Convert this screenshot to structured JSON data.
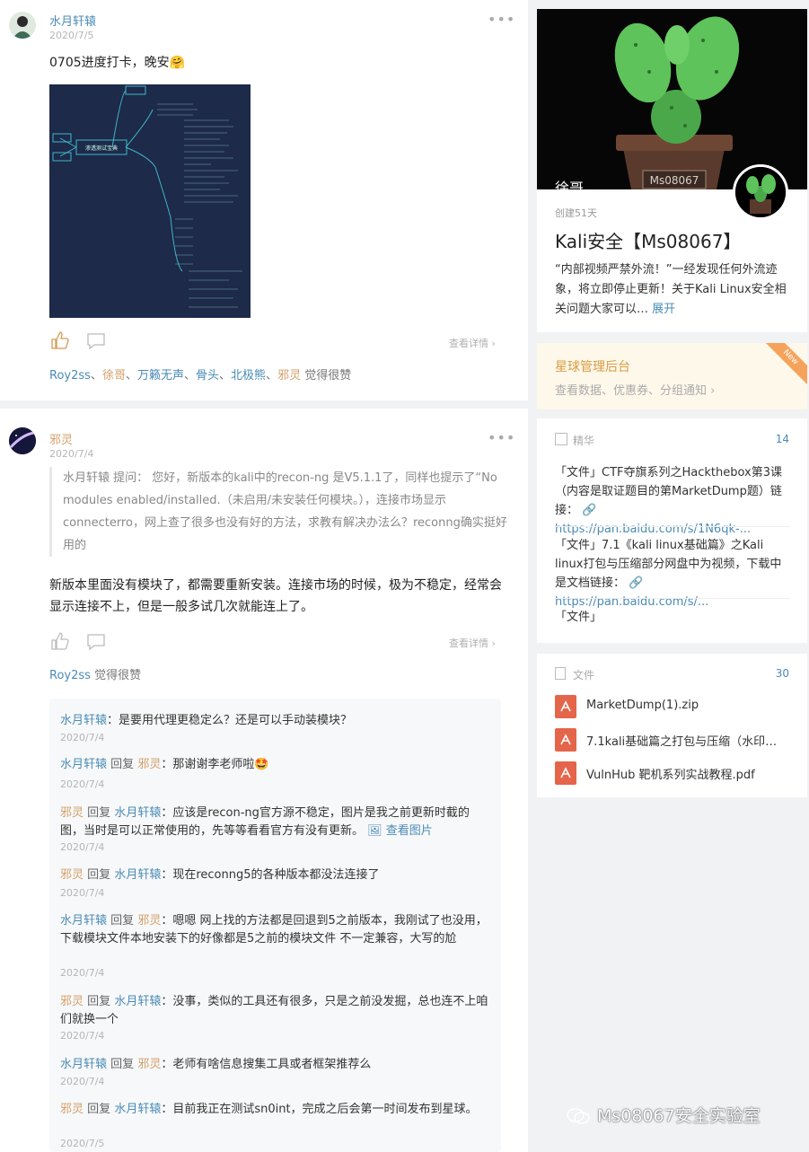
{
  "post1": {
    "author": "水月轩辕",
    "date": "2020/7/5",
    "more": "•••",
    "text": "0705进度打卡，晚安🤗",
    "mindmap_center": "渗透测试宝典",
    "detail_link": "查看详情 ›",
    "likes": {
      "names": [
        "Roy2ss",
        "徐哥",
        "万籁无声",
        "骨头",
        "北极熊",
        "邪灵"
      ],
      "suffix": "觉得很赞"
    }
  },
  "post2": {
    "author": "邪灵",
    "date": "2020/7/4",
    "more": "•••",
    "quote": "水月轩辕  提问：  您好，新版本的kali中的recon-ng 是V5.1.1了，同样也提示了“No modules enabled/installed.（未启用/未安装任何模块。），连接市场显示connecterro，网上查了很多也没有好的方法，求教有解决办法么？reconng确实挺好用的",
    "text": "新版本里面没有模块了，都需要重新安装。连接市场的时候，极为不稳定，经常会显示连接不上，但是一般多试几次就能连上了。",
    "detail_link": "查看详情 ›",
    "likes": {
      "names": [
        "Roy2ss"
      ],
      "suffix": "觉得很赞"
    },
    "comments": [
      {
        "from": "水月轩辕",
        "to": "",
        "text": "：是要用代理更稳定么？还是可以手动装模块？",
        "date": "2020/7/4"
      },
      {
        "from": "水月轩辕",
        "to": "邪灵",
        "text": "：那谢谢李老师啦🤩",
        "date": "2020/7/4"
      },
      {
        "from": "邪灵",
        "to": "水月轩辕",
        "text": "：应该是recon-ng官方源不稳定，图片是我之前更新时截的图，当时是可以正常使用的，先等等看看官方有没有更新。",
        "image_link": "🖼 查看图片",
        "date": "2020/7/4"
      },
      {
        "from": "邪灵",
        "to": "水月轩辕",
        "text": "：现在reconng5的各种版本都没法连接了",
        "date": "2020/7/4"
      },
      {
        "from": "水月轩辕",
        "to": "邪灵",
        "text": "：嗯嗯 网上找的方法都是回退到5之前版本，我刚试了也没用，下载模块文件本地安装下的好像都是5之前的模块文件 不一定兼容，大写的尬",
        "date": "2020/7/4"
      },
      {
        "from": "邪灵",
        "to": "水月轩辕",
        "text": "：没事，类似的工具还有很多，只是之前没发掘，总也连不上咱们就换一个",
        "date": "2020/7/4"
      },
      {
        "from": "水月轩辕",
        "to": "邪灵",
        "text": "：老师有啥信息搜集工具或者框架推荐么",
        "date": "2020/7/4"
      },
      {
        "from": "邪灵",
        "to": "水月轩辕",
        "text": "：目前我正在测试sn0int，完成之后会第一时间发布到星球。",
        "date": "2020/7/5"
      }
    ],
    "reply_word": "回复"
  },
  "group": {
    "owner": "徐哥",
    "created": "创建51天",
    "title": "Kali安全【Ms08067】",
    "desc": "“内部视频严禁外流！”一经发现任何外流迹象，将立即停止更新！关于Kali Linux安全相关问题大家可以…",
    "expand": "展开",
    "pot_label": "Ms08067"
  },
  "admin": {
    "title": "星球管理后台",
    "sub": "查看数据、优惠券、分组通知 ›",
    "ribbon": "New"
  },
  "essence": {
    "label": "精华",
    "count": "14",
    "items": [
      {
        "text": "「文件」CTF夺旗系列之Hackthebox第3课（内容是取证题目的第MarketDump题）链接：",
        "link": "🔗 https://pan.baidu.com/s/1N6qk-..."
      },
      {
        "text": "「文件」7.1《kali linux基础篇》之Kali linux打包与压缩部分网盘中为视频，下载中是文档链接：",
        "link": "🔗 https://pan.baidu.com/s/..."
      },
      {
        "text": "「文件」",
        "link": ""
      }
    ]
  },
  "files": {
    "label": "文件",
    "count": "30",
    "items": [
      "MarketDump(1).zip",
      "7.1kali基础篇之打包与压缩（水印…",
      "VulnHub 靶机系列实战教程.pdf"
    ]
  },
  "watermark": "Ms08067安全实验室",
  "colors": {
    "link_blue": "#4a8bb5",
    "orange_name": "#d3a06a",
    "file_red": "#e5654b"
  }
}
